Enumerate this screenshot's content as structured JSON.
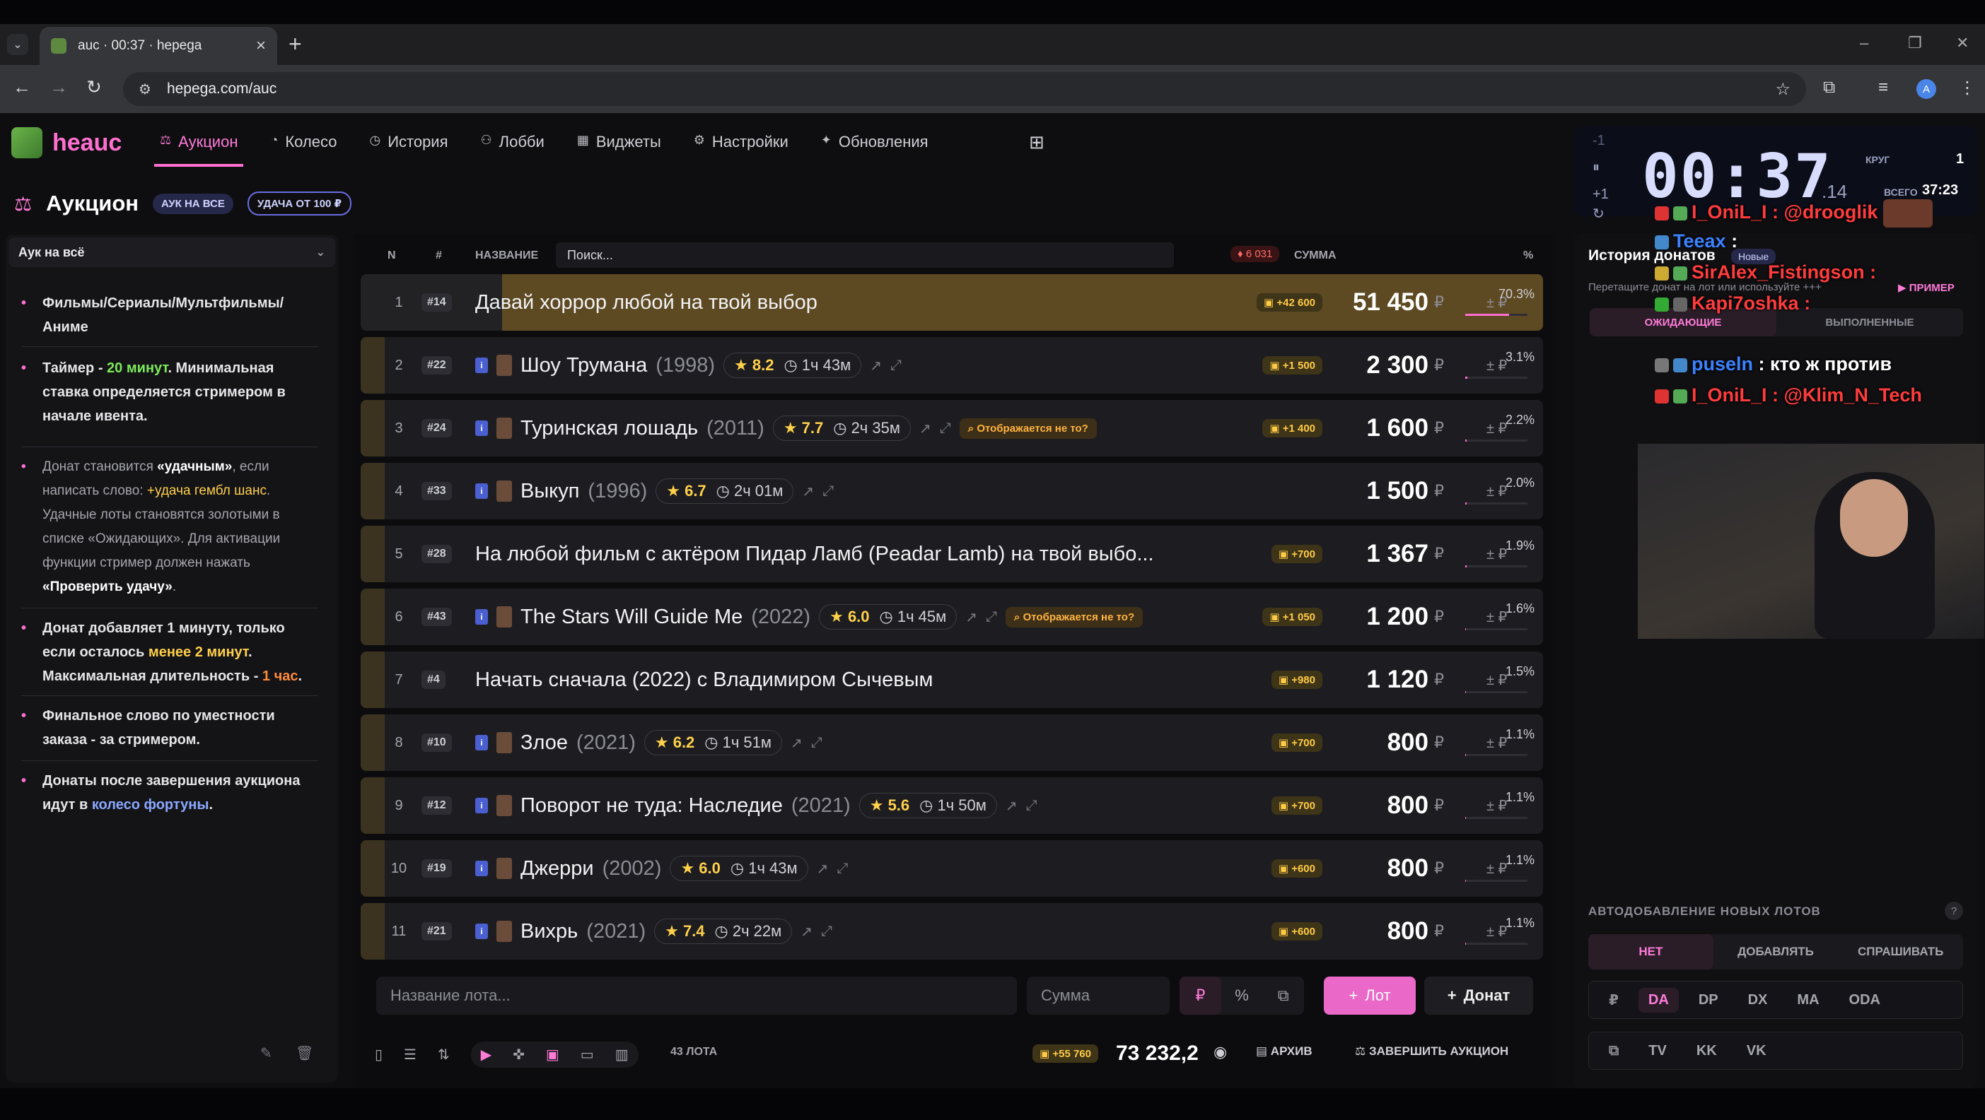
{
  "browser": {
    "tab_title": "auc · 00:37 · hepega",
    "url": "hepega.com/auc"
  },
  "app": {
    "logo_text": "heauc",
    "nav": [
      {
        "label": "Аукцион",
        "icon": "gavel-icon"
      },
      {
        "label": "Колесо",
        "icon": "wheel-icon"
      },
      {
        "label": "История",
        "icon": "history-icon"
      },
      {
        "label": "Лобби",
        "icon": "users-icon"
      },
      {
        "label": "Виджеты",
        "icon": "widgets-icon"
      },
      {
        "label": "Настройки",
        "icon": "gear-icon"
      },
      {
        "label": "Обновления",
        "icon": "sparkle-icon"
      }
    ],
    "page_title": "Аукцион",
    "pills": [
      "АУК НА ВСЕ",
      "УДАЧА ОТ 100 ₽"
    ]
  },
  "left": {
    "preset": "Аук на всё",
    "rules": {
      "r1": "Фильмы/Сериалы/Мультфильмы/Аниме",
      "r2_a": "Таймер - ",
      "r2_b": "20 минут",
      "r2_c": ". Минимальная ставка определяется стримером в начале ивента.",
      "r3_a": "Донат становится ",
      "r3_b": "«удачным»",
      "r3_c": ", если написать слово: ",
      "r3_d": "+удача гембл шанс",
      "r3_e": ". Удачные лоты становятся золотыми в списке «Ожидающих». Для активации функции стример должен нажать ",
      "r3_f": "«Проверить удачу»",
      "r3_g": ".",
      "r4_a": "Донат добавляет 1 минуту, только если осталось ",
      "r4_b": "менее 2 минут",
      "r4_c": ". Максимальная длительность - ",
      "r4_d": "1 час",
      "r4_e": ".",
      "r5": "Финальное слово по уместности заказа - за стримером.",
      "r6_a": "Донаты после завершения аукциона идут в ",
      "r6_b": "колесо фортуны",
      "r6_c": "."
    }
  },
  "table": {
    "headers": {
      "n": "N",
      "hash": "#",
      "name": "НАЗВАНИЕ",
      "sum": "СУММА",
      "pct": "%"
    },
    "search_placeholder": "Поиск...",
    "sum_badge": "6 031",
    "rows": [
      {
        "n": "1",
        "id": "#14",
        "title": "Давай хоррор любой на твой выбор",
        "year": "",
        "rating": "",
        "dur": "",
        "warn": "",
        "add": "+42 600",
        "sum": "51 450",
        "pct": "70.3%",
        "pct_value": 70.3
      },
      {
        "n": "2",
        "id": "#22",
        "title": "Шоу Трумана",
        "year": "(1998)",
        "rating": "8.2",
        "dur": "1ч 43м",
        "warn": "",
        "add": "+1 500",
        "sum": "2 300",
        "pct": "3.1%",
        "pct_value": 3.1
      },
      {
        "n": "3",
        "id": "#24",
        "title": "Туринская лошадь",
        "year": "(2011)",
        "rating": "7.7",
        "dur": "2ч 35м",
        "warn": "Отображается не то?",
        "add": "+1 400",
        "sum": "1 600",
        "pct": "2.2%",
        "pct_value": 2.2
      },
      {
        "n": "4",
        "id": "#33",
        "title": "Выкуп",
        "year": "(1996)",
        "rating": "6.7",
        "dur": "2ч 01м",
        "warn": "",
        "add": "",
        "sum": "1 500",
        "pct": "2.0%",
        "pct_value": 2.0
      },
      {
        "n": "5",
        "id": "#28",
        "title": "На любой фильм с актёром Пидар Ламб (Peadar Lamb) на твой выбо...",
        "year": "",
        "rating": "",
        "dur": "",
        "warn": "",
        "add": "+700",
        "sum": "1 367",
        "pct": "1.9%",
        "pct_value": 1.9
      },
      {
        "n": "6",
        "id": "#43",
        "title": "The Stars Will Guide Me",
        "year": "(2022)",
        "rating": "6.0",
        "dur": "1ч 45м",
        "warn": "Отображается не то?",
        "add": "+1 050",
        "sum": "1 200",
        "pct": "1.6%",
        "pct_value": 1.6
      },
      {
        "n": "7",
        "id": "#4",
        "title": "Начать сначала (2022) с Владимиром Сычевым",
        "year": "",
        "rating": "",
        "dur": "",
        "warn": "",
        "add": "+980",
        "sum": "1 120",
        "pct": "1.5%",
        "pct_value": 1.5
      },
      {
        "n": "8",
        "id": "#10",
        "title": "Злое",
        "year": "(2021)",
        "rating": "6.2",
        "dur": "1ч 51м",
        "warn": "",
        "add": "+700",
        "sum": "800",
        "pct": "1.1%",
        "pct_value": 1.1
      },
      {
        "n": "9",
        "id": "#12",
        "title": "Поворот не туда: Наследие",
        "year": "(2021)",
        "rating": "5.6",
        "dur": "1ч 50м",
        "warn": "",
        "add": "+700",
        "sum": "800",
        "pct": "1.1%",
        "pct_value": 1.1
      },
      {
        "n": "10",
        "id": "#19",
        "title": "Джерри",
        "year": "(2002)",
        "rating": "6.0",
        "dur": "1ч 43м",
        "warn": "",
        "add": "+600",
        "sum": "800",
        "pct": "1.1%",
        "pct_value": 1.1
      },
      {
        "n": "11",
        "id": "#21",
        "title": "Вихрь",
        "year": "(2021)",
        "rating": "7.4",
        "dur": "2ч 22м",
        "warn": "",
        "add": "+600",
        "sum": "800",
        "pct": "1.1%",
        "pct_value": 1.1
      }
    ],
    "currency": "₽",
    "plusminus": "± ₽",
    "lot_placeholder": "Название лота...",
    "sum_placeholder": "Сумма",
    "modes": [
      "₽",
      "%",
      "⧉"
    ],
    "btn_lot": "Лот",
    "btn_donat": "Донат",
    "lots_count": "43 ЛОТА",
    "total_add": "+55 760",
    "total_sum": "73 232,2",
    "archive": "АРХИВ",
    "finish": "ЗАВЕРШИТЬ АУКЦИОН"
  },
  "timer": {
    "minus": "-1",
    "plus": "+1",
    "main": "00:37",
    "ms": ".14",
    "krug_label": "КРУГ",
    "krug_value": "1",
    "vsego_label": "ВСЕГО",
    "vsego_value": "37:23"
  },
  "history": {
    "title": "История донатов",
    "new_badge": "Новые",
    "hint": "Перетащите донат на лот или используйте +++",
    "primer": "ПРИМЕР",
    "tabs": [
      "ОЖИДАЮЩИЕ",
      "ВЫПОЛНЕННЫЕ"
    ]
  },
  "chat": [
    {
      "user": "I_OniL_I",
      "text": "@drooglik"
    },
    {
      "user": "Teeax",
      "text": ""
    },
    {
      "user": "SirAlex_Fistingson",
      "text": ""
    },
    {
      "user": "Kapi7oshka",
      "text": ""
    },
    {
      "user": "puseln",
      "text": "кто ж против"
    },
    {
      "user": "I_OniL_I",
      "text": "@Klim_N_Tech"
    }
  ],
  "autoadd": {
    "title": "АВТОДОБАВЛЕНИЕ НОВЫХ ЛОТОВ",
    "help": "?",
    "options": [
      "НЕТ",
      "ДОБАВЛЯТЬ",
      "СПРАШИВАТЬ"
    ],
    "row1": [
      "₽",
      "DA",
      "DP",
      "DX",
      "MA",
      "ODA"
    ],
    "row2": [
      "⧉",
      "TV",
      "KK",
      "VK"
    ]
  },
  "colors": {
    "accent": "#ff6fd0",
    "gold": "#ffcb45",
    "bg": "#0e0e10"
  }
}
